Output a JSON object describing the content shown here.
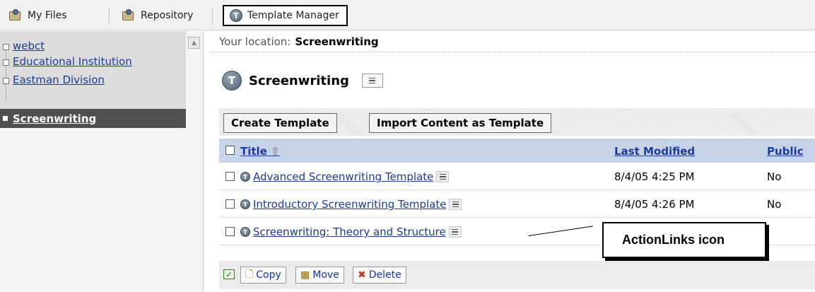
{
  "tabs": {
    "my_files": "My Files",
    "repository": "Repository",
    "template_manager": "Template Manager"
  },
  "tree": {
    "items": [
      {
        "label": "webct"
      },
      {
        "label": "Educational Institution"
      },
      {
        "label": "Eastman Division"
      },
      {
        "label": "Screenwriting"
      }
    ]
  },
  "location": {
    "prefix": "Your location:",
    "value": "Screenwriting"
  },
  "heading": {
    "title": "Screenwriting",
    "icon_letter": "T"
  },
  "toolbar": {
    "create_label": "Create Template",
    "import_label": "Import Content as Template"
  },
  "table": {
    "headers": {
      "title": "Title",
      "sort_indicator": "⇧",
      "last_modified": "Last Modified",
      "public": "Public"
    },
    "rows": [
      {
        "title": "Advanced Screenwriting Template",
        "last_modified": "8/4/05 4:25 PM",
        "public": "No"
      },
      {
        "title": "Introductory Screenwriting Template",
        "last_modified": "8/4/05 4:26 PM",
        "public": "No"
      },
      {
        "title": "Screenwriting: Theory and Structure",
        "last_modified": "",
        "public": ""
      }
    ]
  },
  "footer": {
    "copy_label": "Copy",
    "move_label": "Move",
    "delete_label": "Delete"
  },
  "callout": {
    "label": "ActionLinks icon"
  },
  "colors": {
    "link": "#1a3b9a",
    "header_bg": "#c7d3e8",
    "selected_tree_bg": "#505050"
  }
}
